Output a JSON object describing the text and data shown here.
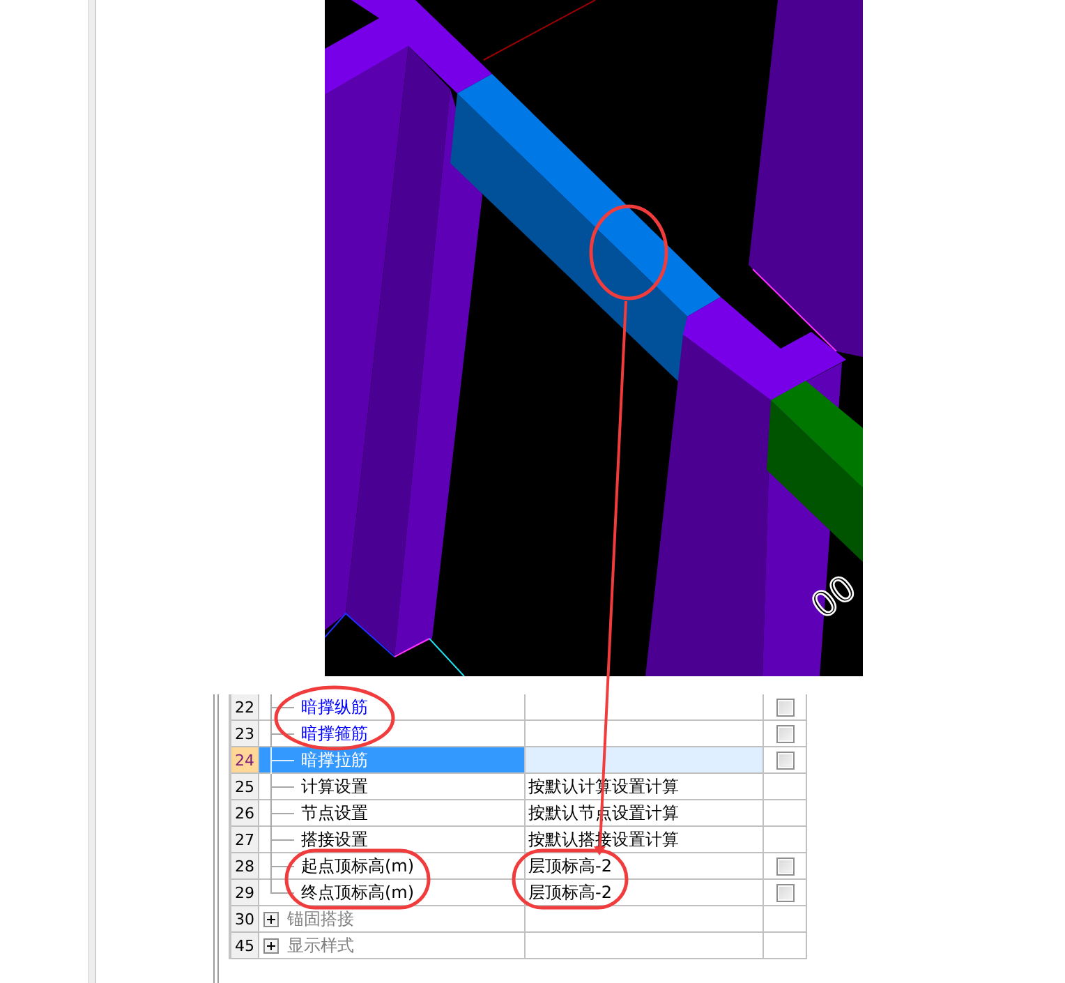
{
  "viewport": {
    "label": "00"
  },
  "property_table": {
    "rows": [
      {
        "number": "22",
        "kind": "property",
        "name": "暗撑纵筋",
        "highlighted": true,
        "selected": false,
        "checkbox": {
          "checked": false
        }
      },
      {
        "number": "23",
        "kind": "property",
        "name": "暗撑箍筋",
        "highlighted": true,
        "selected": false,
        "checkbox": {
          "checked": false
        }
      },
      {
        "number": "24",
        "kind": "property",
        "name": "暗撑拉筋",
        "highlighted": false,
        "selected": true,
        "checkbox": {
          "checked": false
        }
      },
      {
        "number": "25",
        "kind": "property",
        "name": "计算设置",
        "highlighted": false,
        "selected": false,
        "value": "按默认计算设置计算"
      },
      {
        "number": "26",
        "kind": "property",
        "name": "节点设置",
        "highlighted": false,
        "selected": false,
        "value": "按默认节点设置计算"
      },
      {
        "number": "27",
        "kind": "property",
        "name": "搭接设置",
        "highlighted": false,
        "selected": false,
        "value": "按默认搭接设置计算"
      },
      {
        "number": "28",
        "kind": "property",
        "name": "起点顶标高(m)",
        "highlighted": false,
        "selected": false,
        "value": "层顶标高-2",
        "checkbox": {
          "checked": false
        }
      },
      {
        "number": "29",
        "kind": "property",
        "name": "终点顶标高(m)",
        "highlighted": false,
        "selected": false,
        "value": "层顶标高-2",
        "checkbox": {
          "checked": false
        }
      },
      {
        "number": "30",
        "kind": "group",
        "name": "锚固搭接",
        "expanded": false,
        "selected": false
      },
      {
        "number": "45",
        "kind": "group",
        "name": "显示样式",
        "expanded": false,
        "selected": false
      }
    ]
  }
}
